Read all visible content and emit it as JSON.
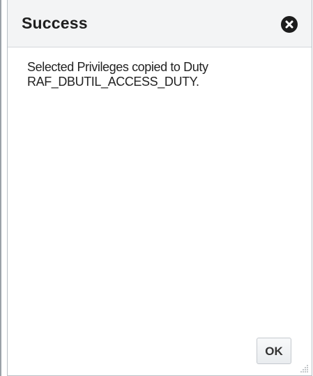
{
  "dialog": {
    "title": "Success",
    "message_line1": "Selected Privileges copied to Duty",
    "message_line2": "RAF_DBUTIL_ACCESS_DUTY.",
    "ok_label": "OK",
    "close_icon": "close-circle-icon",
    "resize_icon": "resize-grip-icon"
  },
  "colors": {
    "title_bar_bg": "#f3f4f5",
    "close_button_bg": "#1c1c1c",
    "text": "#222222"
  }
}
